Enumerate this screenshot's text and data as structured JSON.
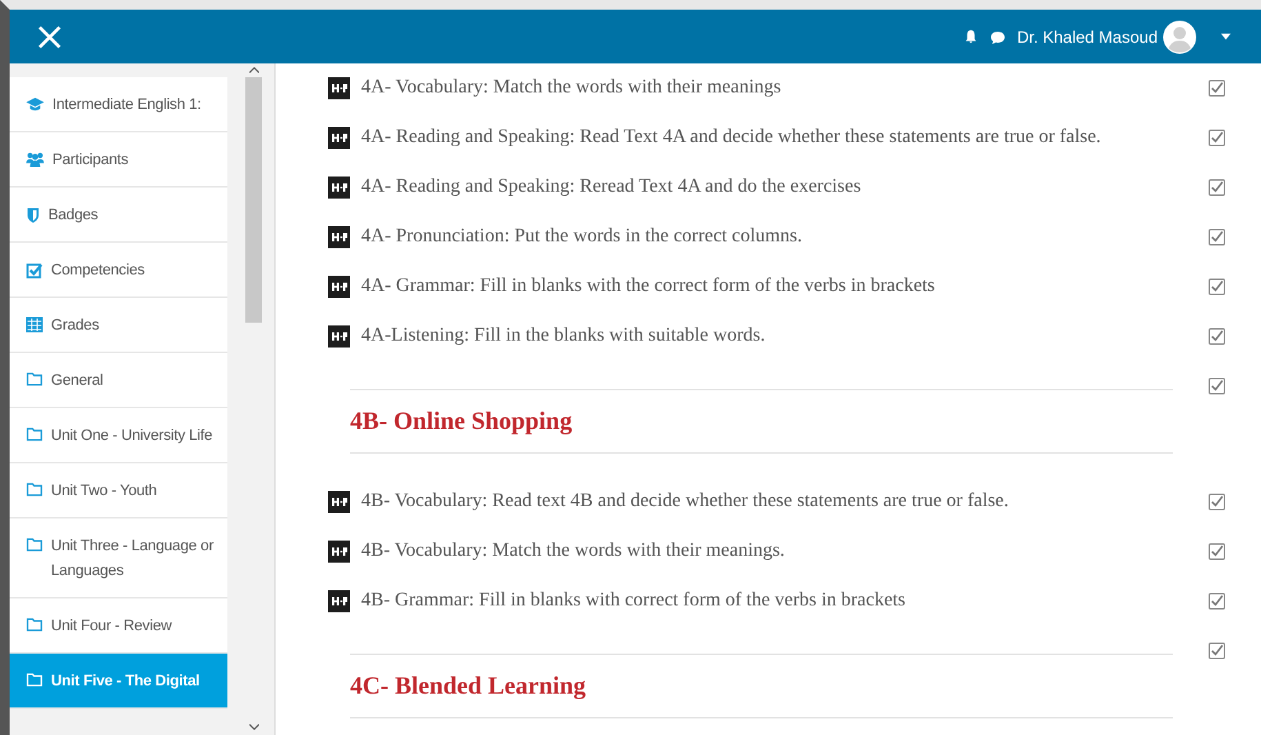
{
  "header": {
    "user_name": "Dr. Khaled Masoud"
  },
  "sidebar": {
    "items": [
      {
        "label": "Intermediate English 1:",
        "selected": false
      },
      {
        "label": "Participants",
        "selected": false
      },
      {
        "label": "Badges",
        "selected": false
      },
      {
        "label": "Competencies",
        "selected": false
      },
      {
        "label": "Grades",
        "selected": false
      },
      {
        "label": "General",
        "selected": false
      },
      {
        "label": "Unit One - University Life",
        "selected": false
      },
      {
        "label": "Unit Two - Youth",
        "selected": false
      },
      {
        "label": "Unit Three - Language or Languages",
        "selected": false
      },
      {
        "label": "Unit Four - Review",
        "selected": false
      },
      {
        "label": "Unit Five - The Digital",
        "selected": true
      }
    ]
  },
  "content": {
    "items": [
      {
        "kind": "activity",
        "title": "4A- Vocabulary: Match the words with their meanings",
        "checked": true
      },
      {
        "kind": "activity",
        "title": "4A- Reading and Speaking: Read Text 4A and decide whether these statements are true or false.",
        "checked": true
      },
      {
        "kind": "activity",
        "title": "4A- Reading and Speaking: Reread Text 4A and do the exercises",
        "checked": true
      },
      {
        "kind": "activity",
        "title": "4A- Pronunciation: Put the words in the correct columns.",
        "checked": true
      },
      {
        "kind": "activity",
        "title": "4A- Grammar: Fill in blanks with the correct form of the verbs in brackets",
        "checked": true
      },
      {
        "kind": "activity",
        "title": "4A-Listening: Fill in the blanks with suitable words.",
        "checked": true
      },
      {
        "kind": "heading",
        "title": "4B- Online Shopping",
        "checked": true
      },
      {
        "kind": "activity",
        "title": "4B- Vocabulary: Read text 4B and decide whether these statements are true or false.",
        "checked": true
      },
      {
        "kind": "activity",
        "title": "4B- Vocabulary: Match the words with their meanings.",
        "checked": true
      },
      {
        "kind": "activity",
        "title": "4B- Grammar: Fill in blanks with correct form of the verbs in brackets",
        "checked": true
      },
      {
        "kind": "heading",
        "title": "4C- Blended Learning",
        "checked": true
      }
    ]
  }
}
